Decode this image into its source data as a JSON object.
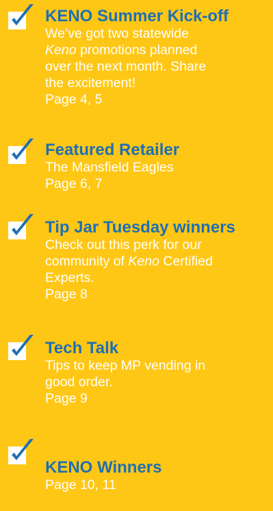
{
  "items": [
    {
      "title": "KENO Summer Kick-off",
      "desc_lines": [
        [
          "We’ve got two statewide"
        ],
        [
          "*Keno*",
          " promotions planned"
        ],
        [
          "over the next month. Share"
        ],
        [
          "the excitement!"
        ]
      ],
      "page": "Page 4, 5"
    },
    {
      "title": "Featured Retailer",
      "desc_lines": [
        [
          "The Mansfield Eagles"
        ]
      ],
      "page": "Page 6, 7"
    },
    {
      "title": "Tip Jar Tuesday winners",
      "desc_lines": [
        [
          "Check out this perk for our"
        ],
        [
          "community of ",
          "*Keno*",
          " Certified"
        ],
        [
          "Experts."
        ]
      ],
      "page": "Page 8"
    },
    {
      "title": "Tech Talk",
      "desc_lines": [
        [
          "Tips to keep MP vending in"
        ],
        [
          "good order."
        ]
      ],
      "page": "Page 9"
    },
    {
      "title": "KENO Winners",
      "desc_lines": [],
      "page": "Page 10, 11"
    }
  ],
  "colors": {
    "background": "#FFC715",
    "title": "#1F6FB3",
    "body_text": "#FFFFFF",
    "check": "#1F6FB3",
    "box": "#FFFFFF"
  },
  "icons": {
    "checkbox": "checkbox-checked-icon"
  }
}
